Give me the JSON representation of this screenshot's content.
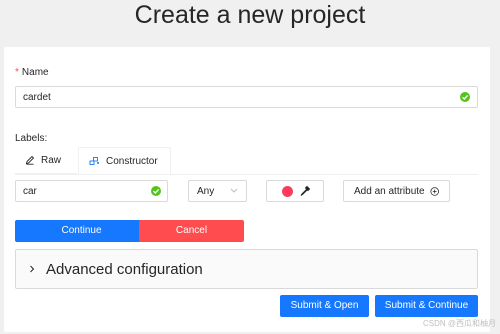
{
  "page": {
    "title": "Create a new project"
  },
  "form": {
    "name_label": "Name",
    "name_required_mark": "*",
    "name_value": "cardet",
    "labels_title": "Labels:",
    "tabs": [
      {
        "label": "Raw",
        "icon": "pencil-icon"
      },
      {
        "label": "Constructor",
        "icon": "constructor-icon"
      }
    ],
    "label_value": "car",
    "attribute_type": "Any",
    "label_color": "#ff3b5a",
    "add_attribute": "Add an attribute"
  },
  "buttons": {
    "continue": "Continue",
    "cancel": "Cancel",
    "submit_open": "Submit & Open",
    "submit_continue": "Submit & Continue"
  },
  "advanced": {
    "label": "Advanced configuration"
  },
  "watermark": "CSDN @西瓜和柚月",
  "colors": {
    "primary": "#1677ff",
    "danger": "#ff4d4f",
    "success": "#52c41a"
  }
}
